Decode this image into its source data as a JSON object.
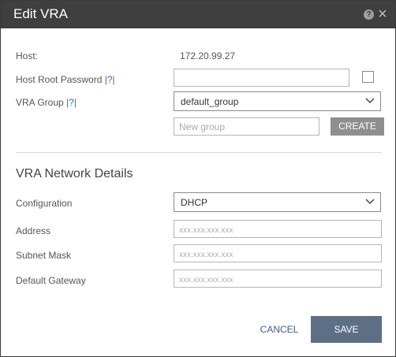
{
  "dialog": {
    "title": "Edit VRA",
    "help_icon": "question-mark-icon",
    "close_icon": "close-x-icon"
  },
  "host": {
    "label": "Host:",
    "value": "172.20.99.27"
  },
  "host_root_password": {
    "label": "Host Root Password",
    "help": "|?|",
    "value": ""
  },
  "vra_group": {
    "label": "VRA Group",
    "help": "|?|",
    "selected": "default_group"
  },
  "new_group": {
    "placeholder": "New group",
    "create_label": "CREATE"
  },
  "network": {
    "section_title": "VRA Network Details",
    "configuration_label": "Configuration",
    "configuration_selected": "DHCP",
    "address_label": "Address",
    "address_placeholder": "xxx.xxx.xxx.xxx",
    "subnet_label": "Subnet Mask",
    "subnet_placeholder": "xxx.xxx.xxx.xxx",
    "gateway_label": "Default Gateway",
    "gateway_placeholder": "xxx.xxx.xxx.xxx"
  },
  "footer": {
    "cancel_label": "CANCEL",
    "save_label": "SAVE"
  },
  "colors": {
    "titlebar": "#3f3f3f",
    "save_button": "#5d6f84",
    "create_button": "#8f8f8f",
    "link": "#3b6fb6"
  }
}
